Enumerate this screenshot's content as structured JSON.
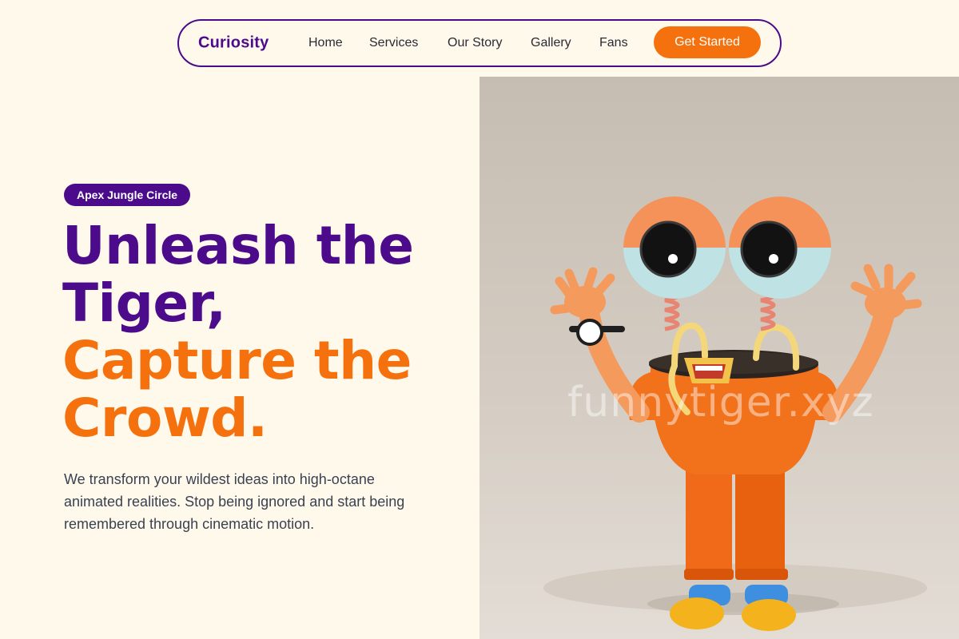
{
  "nav": {
    "brand": "Curiosity",
    "links": [
      "Home",
      "Services",
      "Our Story",
      "Gallery",
      "Fans"
    ],
    "cta_label": "Get Started"
  },
  "hero": {
    "badge": "Apex Jungle Circle",
    "headline": {
      "line1": "Unleash the",
      "line2": "Tiger,",
      "line3": "Capture the",
      "line4": "Crowd."
    },
    "description": "We transform your wildest ideas into high-octane animated realities. Stop being ignored and start being remembered through cinematic motion.",
    "image": {
      "subject": "orange cartoon character with googly eyes on springs",
      "watermark": "funnytiger.xyz"
    }
  },
  "colors": {
    "background": "#fff9ec",
    "primary_purple": "#4b0b8a",
    "accent_orange": "#f5710e"
  }
}
